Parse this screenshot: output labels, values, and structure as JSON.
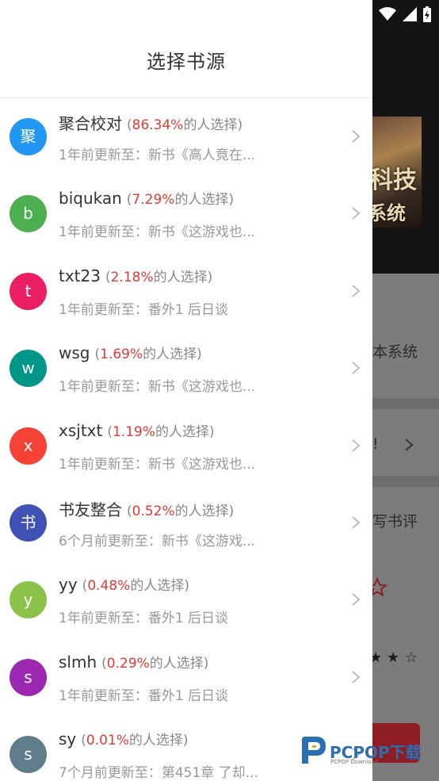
{
  "drawer": {
    "title": "选择书源"
  },
  "background": {
    "cover_title": "科技",
    "cover_title2": "系统",
    "snippet_1": "本系统",
    "snippet_2": "!",
    "snippet_3": "写书评"
  },
  "sources": [
    {
      "avatar": "聚",
      "avatar_color": "#2196F3",
      "name": "聚合校对",
      "open": "(",
      "percent": "86.34%",
      "suffix": "的人选择)",
      "update": "1年前更新至：新书《高人竟在..."
    },
    {
      "avatar": "b",
      "avatar_color": "#4CAF50",
      "name": "biqukan",
      "open": "(",
      "percent": "7.29%",
      "suffix": "的人选择)",
      "update": "1年前更新至：新书《这游戏也..."
    },
    {
      "avatar": "t",
      "avatar_color": "#E91E63",
      "name": "txt23",
      "open": "(",
      "percent": "2.18%",
      "suffix": "的人选择)",
      "update": "1年前更新至：番外1 后日谈"
    },
    {
      "avatar": "w",
      "avatar_color": "#009688",
      "name": "wsg",
      "open": "(",
      "percent": "1.69%",
      "suffix": "的人选择)",
      "update": "1年前更新至：新书《这游戏也..."
    },
    {
      "avatar": "x",
      "avatar_color": "#F44336",
      "name": "xsjtxt",
      "open": "(",
      "percent": "1.19%",
      "suffix": "的人选择)",
      "update": "1年前更新至：新书《这游戏也..."
    },
    {
      "avatar": "书",
      "avatar_color": "#3F51B5",
      "name": "书友整合",
      "open": "(",
      "percent": "0.52%",
      "suffix": "的人选择)",
      "update": "6个月前更新至：新书《这游戏..."
    },
    {
      "avatar": "y",
      "avatar_color": "#8BC34A",
      "name": "yy",
      "open": "(",
      "percent": "0.48%",
      "suffix": "的人选择)",
      "update": "1年前更新至：番外1 后日谈"
    },
    {
      "avatar": "s",
      "avatar_color": "#9C27B0",
      "name": "slmh",
      "open": "(",
      "percent": "0.29%",
      "suffix": "的人选择)",
      "update": "1年前更新至：番外1 后日谈"
    },
    {
      "avatar": "s",
      "avatar_color": "#607D8B",
      "name": "sy",
      "open": "(",
      "percent": "0.01%",
      "suffix": "的人选择)",
      "update": "7个月前更新至：第451章 了却..."
    }
  ],
  "watermark": {
    "text": "PCPOP下载",
    "sub": "PCPOP Download"
  }
}
